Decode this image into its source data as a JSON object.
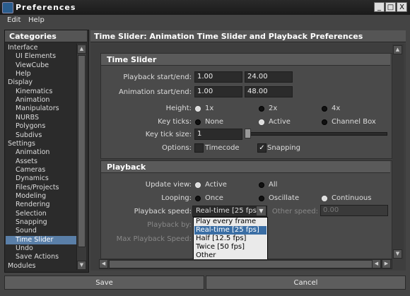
{
  "window": {
    "title": "Preferences",
    "controls": [
      "_",
      "□",
      "X"
    ]
  },
  "menubar": {
    "items": [
      "Edit",
      "Help"
    ]
  },
  "categories": {
    "header": "Categories",
    "items": [
      {
        "label": "Interface",
        "indent": 0
      },
      {
        "label": "UI Elements",
        "indent": 1
      },
      {
        "label": "ViewCube",
        "indent": 1
      },
      {
        "label": "Help",
        "indent": 1
      },
      {
        "label": "Display",
        "indent": 0
      },
      {
        "label": "Kinematics",
        "indent": 1
      },
      {
        "label": "Animation",
        "indent": 1
      },
      {
        "label": "Manipulators",
        "indent": 1
      },
      {
        "label": "NURBS",
        "indent": 1
      },
      {
        "label": "Polygons",
        "indent": 1
      },
      {
        "label": "Subdivs",
        "indent": 1
      },
      {
        "label": "Settings",
        "indent": 0
      },
      {
        "label": "Animation",
        "indent": 1
      },
      {
        "label": "Assets",
        "indent": 1
      },
      {
        "label": "Cameras",
        "indent": 1
      },
      {
        "label": "Dynamics",
        "indent": 1
      },
      {
        "label": "Files/Projects",
        "indent": 1
      },
      {
        "label": "Modeling",
        "indent": 1
      },
      {
        "label": "Rendering",
        "indent": 1
      },
      {
        "label": "Selection",
        "indent": 1
      },
      {
        "label": "Snapping",
        "indent": 1
      },
      {
        "label": "Sound",
        "indent": 1
      },
      {
        "label": "Time Slider",
        "indent": 1,
        "selected": true
      },
      {
        "label": "Undo",
        "indent": 1
      },
      {
        "label": "Save Actions",
        "indent": 1
      },
      {
        "label": "Modules",
        "indent": 0
      }
    ]
  },
  "panel": {
    "title": "Time Slider: Animation Time Slider and Playback Preferences"
  },
  "time_slider": {
    "header": "Time Slider",
    "playback_label": "Playback start/end:",
    "playback_start": "1.00",
    "playback_end": "24.00",
    "animation_label": "Animation start/end:",
    "animation_start": "1.00",
    "animation_end": "48.00",
    "height_label": "Height:",
    "height_options": [
      "1x",
      "2x",
      "4x"
    ],
    "height_selected": "1x",
    "keyticks_label": "Key ticks:",
    "keyticks_options": [
      "None",
      "Active",
      "Channel Box"
    ],
    "keyticks_selected": "Active",
    "keyticksize_label": "Key tick size:",
    "keyticksize_value": "1",
    "keyticksize_level": 0,
    "options_label": "Options:",
    "timecode_label": "Timecode",
    "timecode_checked": false,
    "snapping_label": "Snapping",
    "snapping_checked": true
  },
  "playback": {
    "header": "Playback",
    "update_label": "Update view:",
    "update_options": [
      "Active",
      "All"
    ],
    "update_selected": "Active",
    "looping_label": "Looping:",
    "looping_options": [
      "Once",
      "Oscillate",
      "Continuous"
    ],
    "looping_selected": "Continuous",
    "speed_label": "Playback speed:",
    "speed_value": "Real-time [25 fps]",
    "other_speed_label": "Other speed:",
    "other_speed_value": "0.00",
    "playback_by_label": "Playback by:",
    "max_speed_label": "Max Playback Speed:",
    "speed_menu": [
      "Play every frame",
      "Real-time [25 fps]",
      "Half [12.5 fps]",
      "Twice [50 fps]",
      "Other"
    ],
    "speed_menu_highlight": "Real-time [25 fps]"
  },
  "buttons": {
    "save": "Save",
    "cancel": "Cancel"
  },
  "colors": {
    "selection": "#5a7fa8",
    "menu_highlight": "#3a6ea5",
    "background": "#444444"
  }
}
